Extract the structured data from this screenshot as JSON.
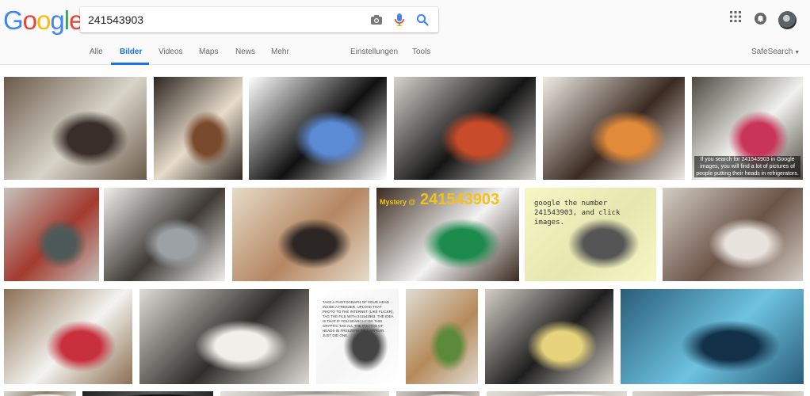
{
  "logo": {
    "letters": [
      "G",
      "o",
      "o",
      "g",
      "l",
      "e"
    ],
    "colors": [
      "#4285F4",
      "#EA4335",
      "#FBBC05",
      "#4285F4",
      "#34A853",
      "#EA4335"
    ]
  },
  "search": {
    "query": "241543903",
    "camera_icon": "camera-icon",
    "mic_icon": "microphone-icon",
    "search_icon": "search-icon"
  },
  "header_right": {
    "apps_icon": "apps-grid-icon",
    "notifications_icon": "notifications-icon",
    "avatar": "avatar"
  },
  "tabs": [
    {
      "label": "Alle",
      "active": false
    },
    {
      "label": "Bilder",
      "active": true
    },
    {
      "label": "Videos",
      "active": false
    },
    {
      "label": "Maps",
      "active": false
    },
    {
      "label": "News",
      "active": false
    },
    {
      "label": "Mehr",
      "active": false
    }
  ],
  "tools": {
    "settings": "Einstellungen",
    "tools": "Tools",
    "safesearch": "SafeSearch"
  },
  "colors": {
    "accent": "#1a73e8",
    "tab_text": "#666666"
  },
  "results": [
    {
      "caption": "",
      "colors": [
        "#6b5a4a",
        "#d8d4c9",
        "#3a2e29"
      ]
    },
    {
      "caption": "",
      "colors": [
        "#2d2620",
        "#e7dccb",
        "#7a4a2c"
      ]
    },
    {
      "caption": "",
      "colors": [
        "#ffffff",
        "#101010",
        "#5c8bd6"
      ]
    },
    {
      "caption": "",
      "colors": [
        "#d5d3cc",
        "#151515",
        "#c84c2a"
      ]
    },
    {
      "caption": "",
      "colors": [
        "#efece5",
        "#3b2a22",
        "#e08a3a"
      ]
    },
    {
      "caption": "If you search for 241543903 in Google images, you will find a lot of pictures of people putting their heads in refrigerators.",
      "colors": [
        "#4d4a3f",
        "#f1f1ee",
        "#c9355a"
      ]
    },
    {
      "caption": "",
      "colors": [
        "#c6c3bd",
        "#a33a2e",
        "#4e5a58"
      ]
    },
    {
      "caption": "",
      "colors": [
        "#f0efec",
        "#3f3a36",
        "#9ba1a5"
      ]
    },
    {
      "caption": "",
      "colors": [
        "#e7dbc7",
        "#b58662",
        "#2c2624"
      ]
    },
    {
      "caption": "241543903",
      "sub": "Mystery @",
      "colors": [
        "#3a2a1e",
        "#f3f3f3",
        "#1d8a4e"
      ]
    },
    {
      "caption": "google the number 241543903, and click images.",
      "colors": [
        "#f6f7c3",
        "#e6e6b0",
        "#555555"
      ]
    },
    {
      "caption": "",
      "colors": [
        "#d4cec6",
        "#6b5347",
        "#e7e2dc"
      ]
    },
    {
      "caption": "",
      "colors": [
        "#8c6f52",
        "#f3f3f0",
        "#c8303d"
      ]
    },
    {
      "caption": "",
      "colors": [
        "#dddcd6",
        "#2f2e2a",
        "#f0efe9"
      ]
    },
    {
      "caption": "TAKE A PHOTOGRAPH OF YOUR HEAD INSIDE A FREEZER. UPLOAD THAT PHOTO TO THE INTERNET (LIKE FLICKR), TAG THE FILE WITH 241543903. THE IDEA IS THAT IF YOU SEARCH FOR THIS CRYPTIC TAG ALL THE PHOTOS OF HEADS IN FREEZERS WILL APPEAR. JUST DID ONE.",
      "colors": [
        "#ffffff",
        "#f5f5f5",
        "#444444"
      ]
    },
    {
      "caption": "",
      "colors": [
        "#e0dcd3",
        "#b58a5a",
        "#5a8a3a"
      ]
    },
    {
      "caption": "",
      "colors": [
        "#d4cfc7",
        "#1f1f1f",
        "#e6d37c"
      ]
    },
    {
      "caption": "",
      "colors": [
        "#2a5d7a",
        "#6ec3e0",
        "#13324a"
      ]
    },
    {
      "caption": "",
      "colors": [
        "#d9d6cf",
        "#8a7c6a",
        "#ece8e0"
      ]
    },
    {
      "caption": "",
      "colors": [
        "#222222",
        "#5a5a5a",
        "#111111"
      ]
    },
    {
      "caption": "",
      "colors": [
        "#e6e3dc",
        "#9c9890",
        "#cfcbc3"
      ]
    },
    {
      "caption": "",
      "colors": [
        "#cfcac1",
        "#8a857c",
        "#e1ddd4"
      ]
    },
    {
      "caption": "",
      "colors": [
        "#e2dfd8",
        "#b6b1a8",
        "#f0eee9"
      ]
    },
    {
      "caption": "",
      "colors": [
        "#d8d5cf",
        "#a9a49b",
        "#ebe8e2"
      ]
    }
  ]
}
